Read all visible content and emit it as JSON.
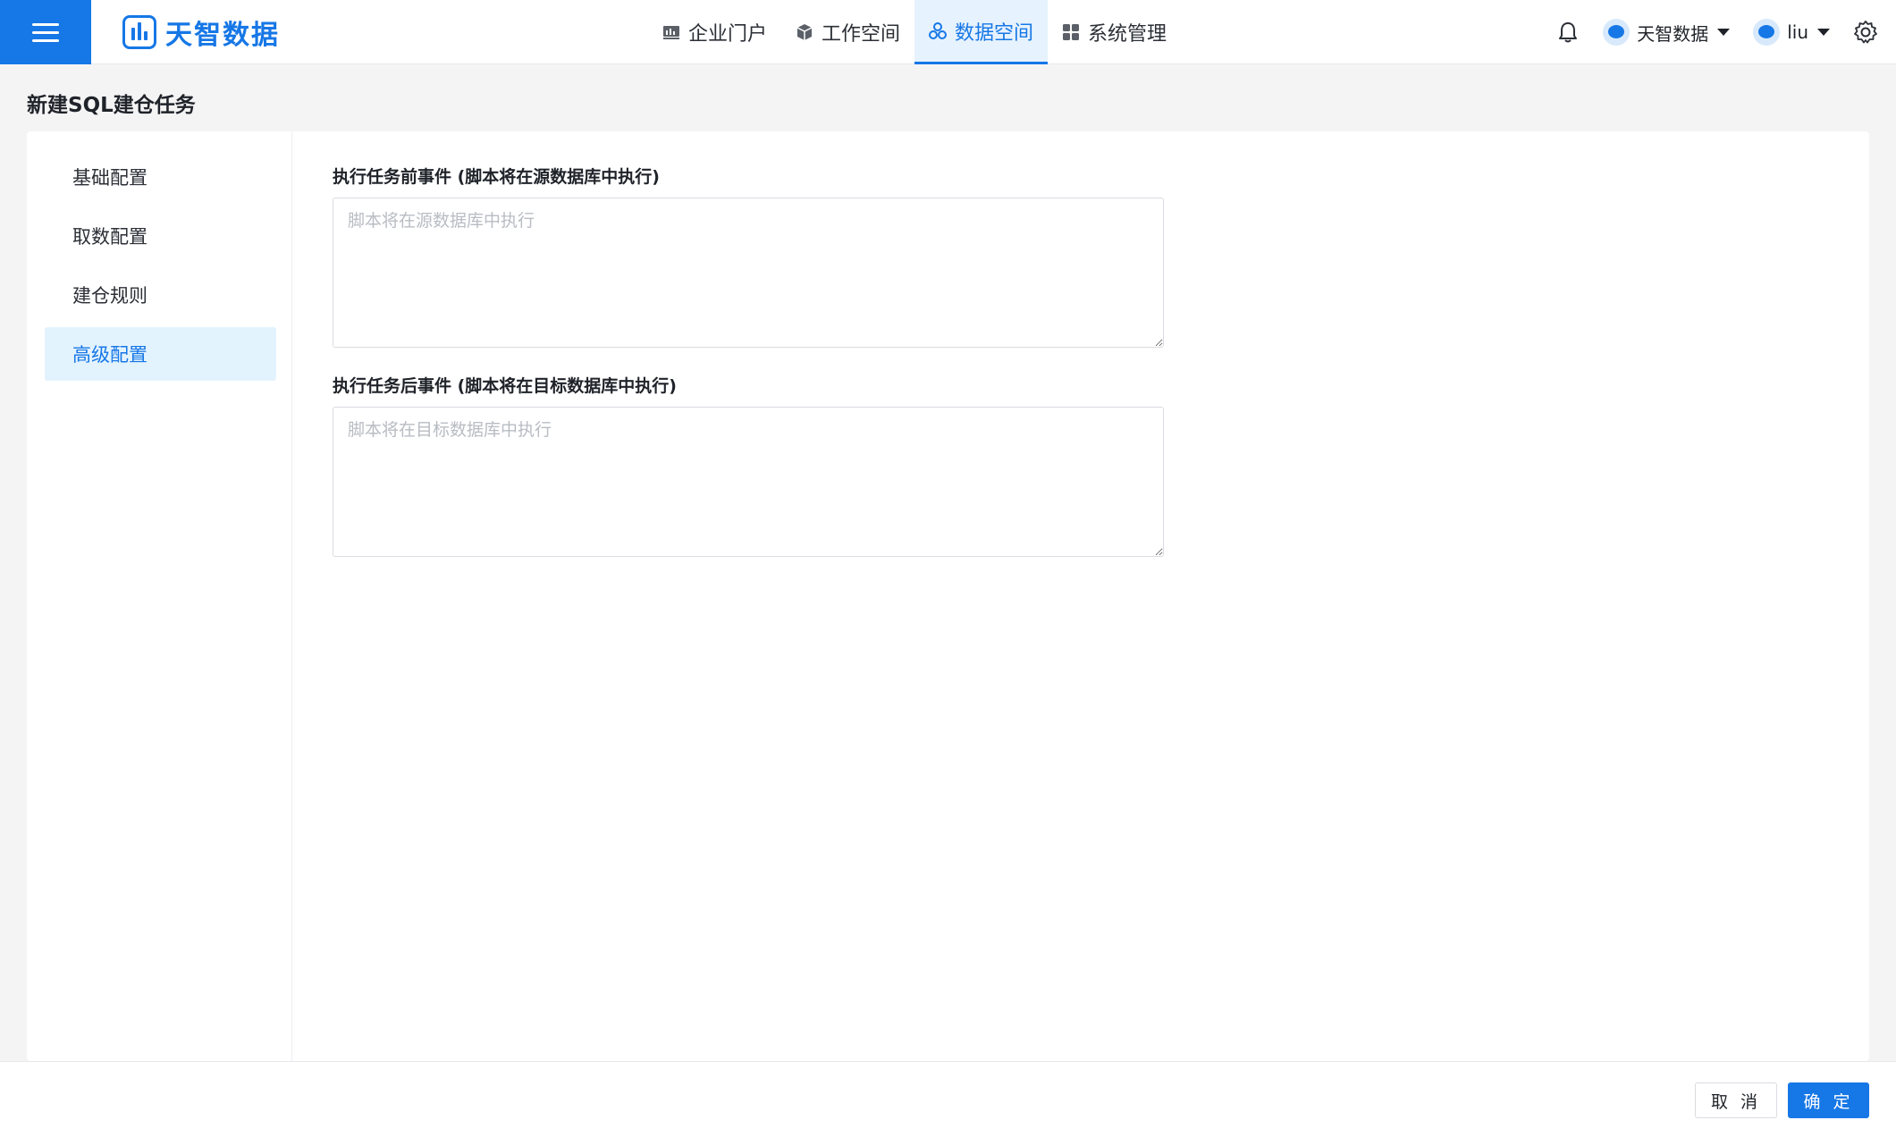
{
  "header": {
    "logo_text": "天智数据",
    "nav": [
      {
        "label": "企业门户",
        "icon": "chart-icon"
      },
      {
        "label": "工作空间",
        "icon": "cube-icon"
      },
      {
        "label": "数据空间",
        "icon": "cluster-icon",
        "active": true
      },
      {
        "label": "系统管理",
        "icon": "grid-icon"
      }
    ],
    "org_label": "天智数据",
    "user_label": "liu"
  },
  "page": {
    "title": "新建SQL建仓任务"
  },
  "sidebar": {
    "items": [
      {
        "label": "基础配置"
      },
      {
        "label": "取数配置"
      },
      {
        "label": "建仓规则"
      },
      {
        "label": "高级配置",
        "active": true
      }
    ]
  },
  "form": {
    "pre_event": {
      "label": "执行任务前事件 (脚本将在源数据库中执行)",
      "placeholder": "脚本将在源数据库中执行",
      "value": ""
    },
    "post_event": {
      "label": "执行任务后事件 (脚本将在目标数据库中执行)",
      "placeholder": "脚本将在目标数据库中执行",
      "value": ""
    }
  },
  "footer": {
    "cancel_label": "取 消",
    "ok_label": "确 定"
  },
  "colors": {
    "accent": "#1677e6",
    "active_bg": "#e3f3fe"
  }
}
